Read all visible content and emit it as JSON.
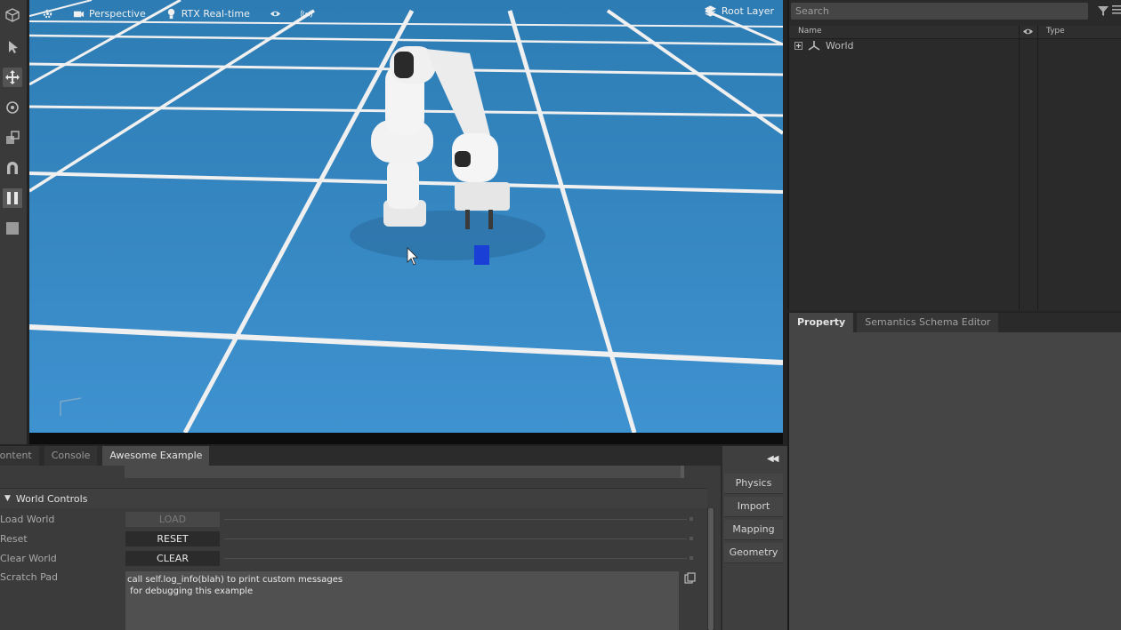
{
  "viewport": {
    "camera_label": "Perspective",
    "renderer_label": "RTX Real-time",
    "layer_label": "Root Layer"
  },
  "stage": {
    "search_placeholder": "Search",
    "columns": {
      "name": "Name",
      "type": "Type"
    },
    "tree": [
      {
        "label": "World"
      }
    ]
  },
  "property_panel": {
    "tabs": [
      {
        "label": "Property",
        "active": true
      },
      {
        "label": "Semantics Schema Editor",
        "active": false
      }
    ]
  },
  "bottom_panel": {
    "tabs": [
      {
        "label": "Content",
        "active": false
      },
      {
        "label": "Console",
        "active": false
      },
      {
        "label": "Awesome Example",
        "active": true
      }
    ],
    "section_title": "World Controls",
    "rows": [
      {
        "label": "Load World",
        "button": "LOAD",
        "enabled": false
      },
      {
        "label": "Reset",
        "button": "RESET",
        "enabled": true
      },
      {
        "label": "Clear World",
        "button": "CLEAR",
        "enabled": true
      }
    ],
    "scratch_label": "Scratch Pad",
    "scratch_text": "call self.log_info(blah) to print custom messages\n for debugging this example"
  },
  "side_panel": {
    "buttons": [
      "Physics",
      "Import",
      "Mapping",
      "Geometry"
    ]
  },
  "colors": {
    "floor": "#3a8cc6",
    "grid_lines": "#f2f2f2",
    "cube": "#1a3fd6",
    "panel_bg": "#3b3b3b"
  }
}
